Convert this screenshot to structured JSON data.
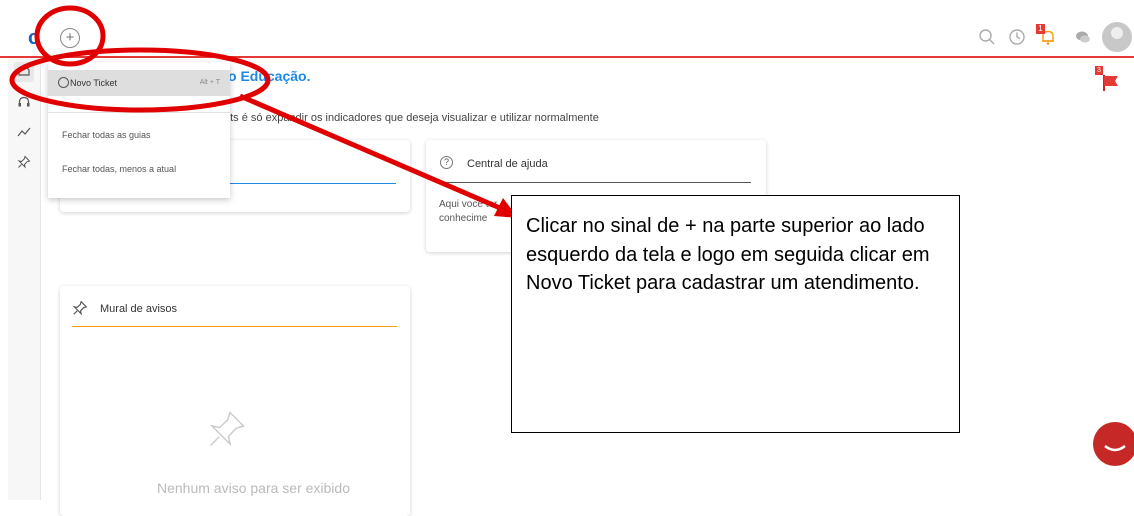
{
  "header": {
    "logo": "c",
    "add_button": "+",
    "notification_badge": "1",
    "icons": [
      "search-icon",
      "history-icon",
      "bell-icon",
      "chat-icon",
      "avatar"
    ]
  },
  "sidebar": {
    "items": [
      "home-icon",
      "headset-icon",
      "trend-icon",
      "pin-icon"
    ]
  },
  "dropdown": {
    "new_ticket": "Novo Ticket",
    "new_ticket_shortcut": "Alt + T",
    "close_all": "Fechar todas as guias",
    "close_others": "Fechar todas, menos a atual"
  },
  "main": {
    "welcome_fragment": "o Educação.",
    "subtitle_fragment": "ckets é só expandir os indicadores que deseja visualizar e utilizar normalmente",
    "help_card": {
      "title": "Central de ajuda",
      "text_fragment": "Aqui você ter conhecime"
    },
    "mural": {
      "title": "Mural de avisos",
      "empty": "Nenhum aviso para ser exibido"
    },
    "flag_badge": "3"
  },
  "annotation": {
    "text": "Clicar no sinal de + na parte superior ao lado esquerdo da tela e logo em seguida clicar em Novo Ticket para cadastrar um atendimento.",
    "color": "#e00000"
  }
}
